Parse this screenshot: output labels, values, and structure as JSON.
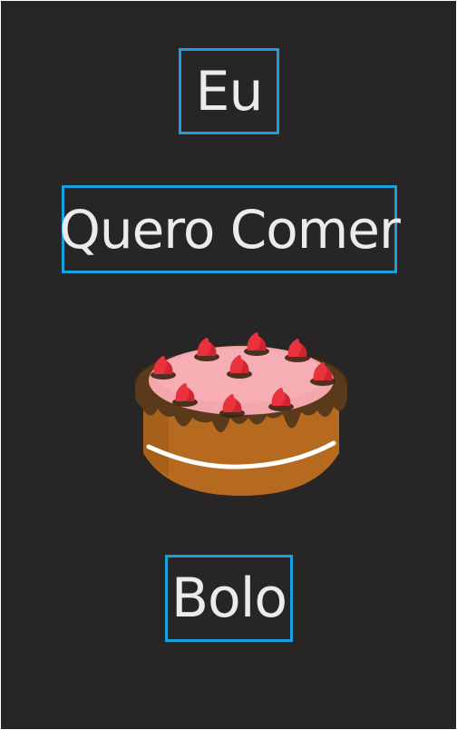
{
  "words": {
    "first": "Eu",
    "second": "Quero Comer",
    "third": "Bolo"
  },
  "image": {
    "icon": "cake-icon"
  },
  "colors": {
    "background": "#272526",
    "border_accent": "#19a0df",
    "text": "#ebebeb",
    "cake_sponge": "#b66a20",
    "cake_chocolate": "#5a3a1a",
    "cake_frosting": "#f4a6ad",
    "strawberry": "#e8333f"
  }
}
